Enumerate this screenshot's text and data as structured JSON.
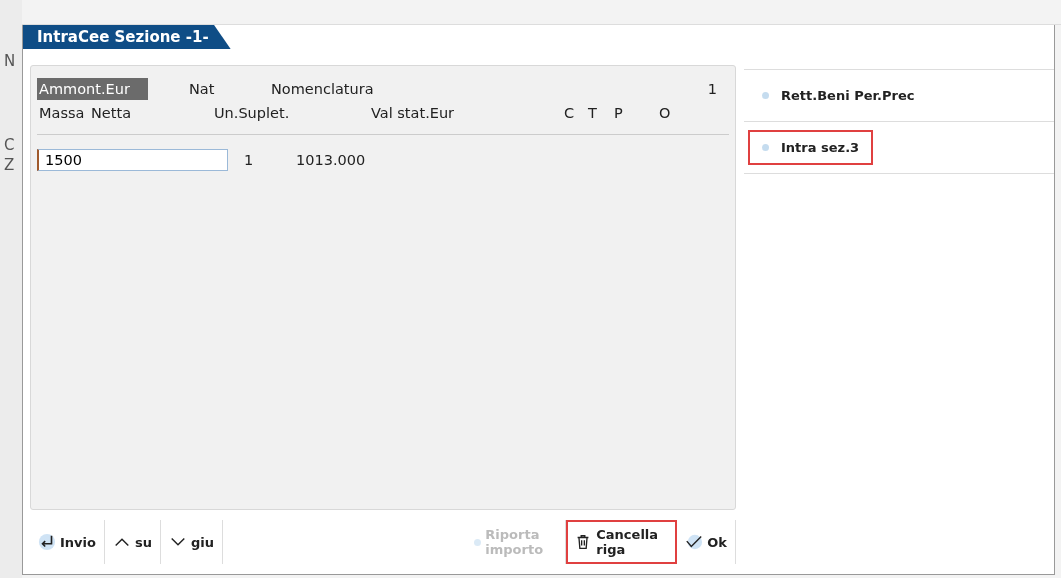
{
  "window": {
    "title": "IntraCee Sezione -1-"
  },
  "background_letters": [
    "N",
    "C",
    "Z"
  ],
  "header_row_1": [
    {
      "label": "Ammont.Eur",
      "selected": true
    },
    {
      "label": "Nat",
      "selected": false
    },
    {
      "label": "Nomenclatura",
      "selected": false
    },
    {
      "label": "1",
      "selected": false
    }
  ],
  "header_row_2": [
    "Massa",
    "Netta",
    "Un.Suplet.",
    "Val stat.Eur",
    "C",
    "T",
    "P",
    "O"
  ],
  "row": {
    "amount": "1500",
    "nat": "1",
    "nomenclatura": "1013.000"
  },
  "side_items": [
    {
      "label": "Rett.Beni Per.Prec",
      "highlighted": false
    },
    {
      "label": "Intra sez.3",
      "highlighted": true
    }
  ],
  "buttons_left": [
    {
      "label": "Invio",
      "kind": "enter",
      "disabled": false,
      "highlighted": false
    },
    {
      "label": "su",
      "kind": "up",
      "disabled": false,
      "highlighted": false
    },
    {
      "label": "giu",
      "kind": "down",
      "disabled": false,
      "highlighted": false
    }
  ],
  "buttons_right": [
    {
      "label": "Riporta importo",
      "kind": "dot",
      "disabled": true,
      "highlighted": false
    },
    {
      "label": "Cancella riga",
      "kind": "trash",
      "disabled": false,
      "highlighted": true
    },
    {
      "label": "Ok",
      "kind": "check",
      "disabled": false,
      "highlighted": false
    }
  ]
}
